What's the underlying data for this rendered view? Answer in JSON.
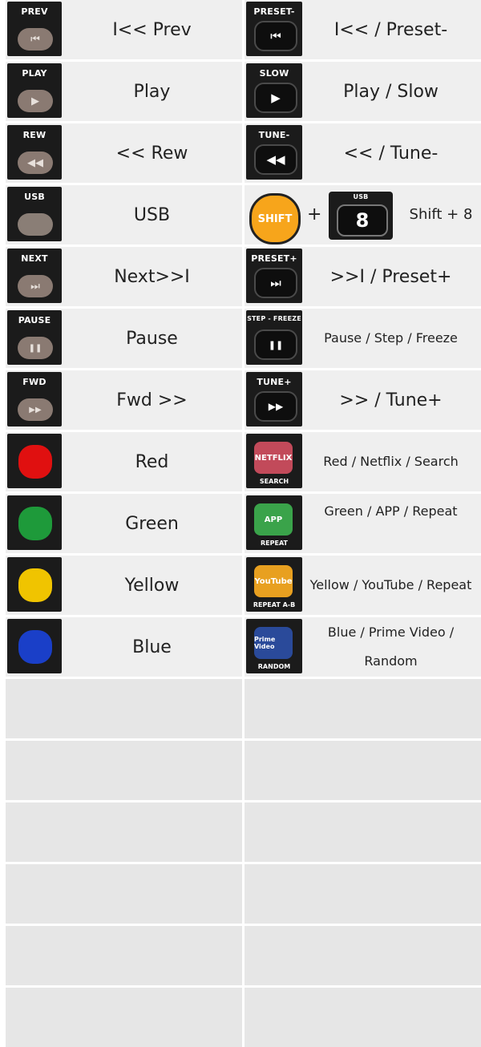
{
  "rows": [
    {
      "left_cap": "PREV",
      "left_glyph": "⏮",
      "left_label": "I<< Prev",
      "right_cap": "PRESET-",
      "right_glyph": "⏮",
      "right_label": "I<< / Preset-"
    },
    {
      "left_cap": "PLAY",
      "left_glyph": "▶",
      "left_label": "Play",
      "right_cap": "SLOW",
      "right_glyph": "▶",
      "right_label": "Play / Slow"
    },
    {
      "left_cap": "REW",
      "left_glyph": "◀◀",
      "left_label": "<< Rew",
      "right_cap": "TUNE-",
      "right_glyph": "◀◀",
      "right_label": "<< / Tune-"
    },
    {
      "left_cap": "USB",
      "left_glyph": "",
      "left_label": "USB",
      "shift_text": "SHIFT",
      "plus": "+",
      "eight_cap": "USB",
      "eight_key": "8",
      "right_label": "Shift + 8"
    },
    {
      "left_cap": "NEXT",
      "left_glyph": "⏭",
      "left_label": "Next>>I",
      "right_cap": "PRESET+",
      "right_glyph": "⏭",
      "right_label": ">>I / Preset+"
    },
    {
      "left_cap": "PAUSE",
      "left_glyph": "❚❚",
      "left_label": "Pause",
      "right_cap": "STEP - FREEZE",
      "right_glyph": "❚❚",
      "right_label": "Pause / Step / Freeze"
    },
    {
      "left_cap": "FWD",
      "left_glyph": "▶▶",
      "left_label": "Fwd >>",
      "right_cap": "TUNE+",
      "right_glyph": "▶▶",
      "right_label": ">> / Tune+"
    },
    {
      "left_color": "#e01010",
      "left_label": "Red",
      "right_btn": "NETFLIX",
      "right_btn_color": "#c24a5a",
      "right_sub": "SEARCH",
      "right_label": "Red / Netflix / Search"
    },
    {
      "left_color": "#1e9a3a",
      "left_label": "Green",
      "right_btn": "APP",
      "right_btn_color": "#3aa34a",
      "right_sub": "REPEAT",
      "right_label": "Green / APP / Repeat"
    },
    {
      "left_color": "#f0c400",
      "left_label": "Yellow",
      "right_btn": "YouTube",
      "right_btn_color": "#e8a020",
      "right_sub": "REPEAT A-B",
      "right_label": "Yellow / YouTube / Repeat"
    },
    {
      "left_color": "#1a3fc8",
      "left_label": "Blue",
      "right_btn": "Prime Video",
      "right_btn_color": "#2a4a9a",
      "right_sub": "RANDOM",
      "right_label": "Blue / Prime Video / Random"
    }
  ]
}
